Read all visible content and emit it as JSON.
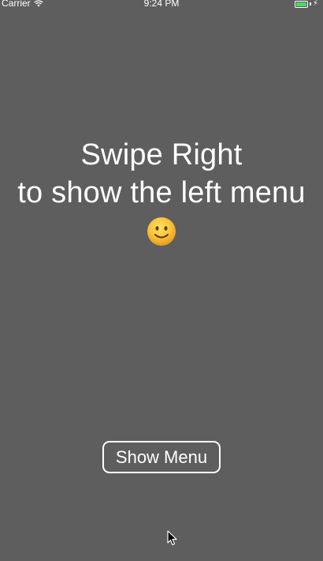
{
  "status_bar": {
    "carrier": "Carrier",
    "time": "9:24 PM",
    "wifi_icon": "wifi-icon",
    "battery_icon": "battery-icon",
    "battery_color": "#4cd964"
  },
  "main": {
    "line1": "Swipe Right",
    "line2": "to show the left menu",
    "emoji_icon": "slightly-smiling-face-icon",
    "background_color": "#5e5e5e"
  },
  "button": {
    "label": "Show Menu"
  }
}
